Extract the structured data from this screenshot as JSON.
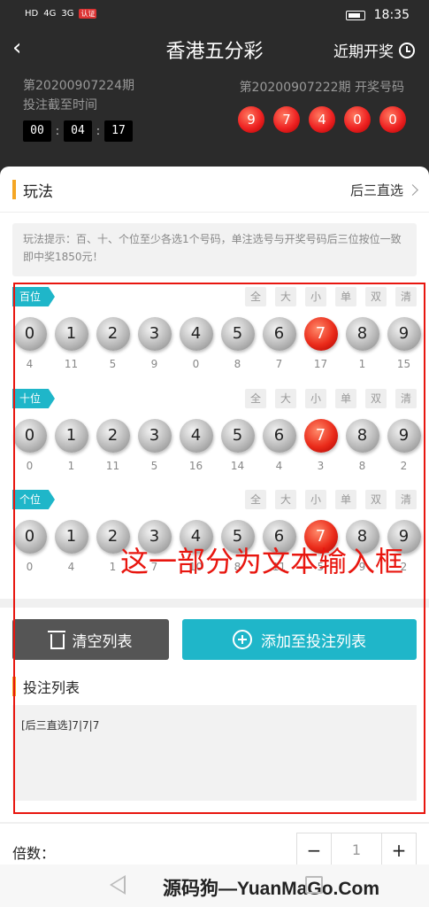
{
  "status_bar": {
    "network": "HD",
    "signal1": "4G",
    "signal2": "3G",
    "badge": "认证",
    "time": "18:35"
  },
  "header": {
    "title": "香港五分彩",
    "recent_label": "近期开奖",
    "current_issue": "第20200907224期",
    "deadline_label": "投注截至时间",
    "timer": {
      "hh": "00",
      "mm": "04",
      "ss": "17"
    },
    "previous_issue": "第20200907222期 开奖号码",
    "draw_numbers": [
      "9",
      "7",
      "4",
      "0",
      "0"
    ]
  },
  "play": {
    "label": "玩法",
    "type": "后三直选"
  },
  "hint": "玩法提示：百、十、个位至少各选1个号码，单注选号与开奖号码后三位按位一致即中奖1850元！",
  "filters": [
    "全",
    "大",
    "小",
    "单",
    "双",
    "清"
  ],
  "groups": [
    {
      "label": "百位",
      "selected": 7,
      "missing": [
        "4",
        "11",
        "5",
        "9",
        "0",
        "8",
        "7",
        "17",
        "1",
        "15"
      ]
    },
    {
      "label": "十位",
      "selected": 7,
      "missing": [
        "0",
        "1",
        "11",
        "5",
        "16",
        "14",
        "4",
        "3",
        "8",
        "2"
      ]
    },
    {
      "label": "个位",
      "selected": 7,
      "missing": [
        "0",
        "4",
        "1",
        "7",
        "10",
        "8",
        "11",
        "5",
        "9",
        "2"
      ]
    }
  ],
  "balls": [
    "0",
    "1",
    "2",
    "3",
    "4",
    "5",
    "6",
    "7",
    "8",
    "9"
  ],
  "actions": {
    "clear_label": "清空列表",
    "add_label": "添加至投注列表"
  },
  "bet_list": {
    "title": "投注列表",
    "content": "[后三直选]7|7|7"
  },
  "annotation": "这一部分为文本输入框",
  "multiplier": {
    "label": "倍数：",
    "minus": "−",
    "value": "1",
    "plus": "+"
  },
  "watermark": "源码狗—YuanMaGo.Com",
  "colors": {
    "selected_ball": "#ea2b1a",
    "accent": "#1fb6c9",
    "annotation": "#e8160f"
  }
}
